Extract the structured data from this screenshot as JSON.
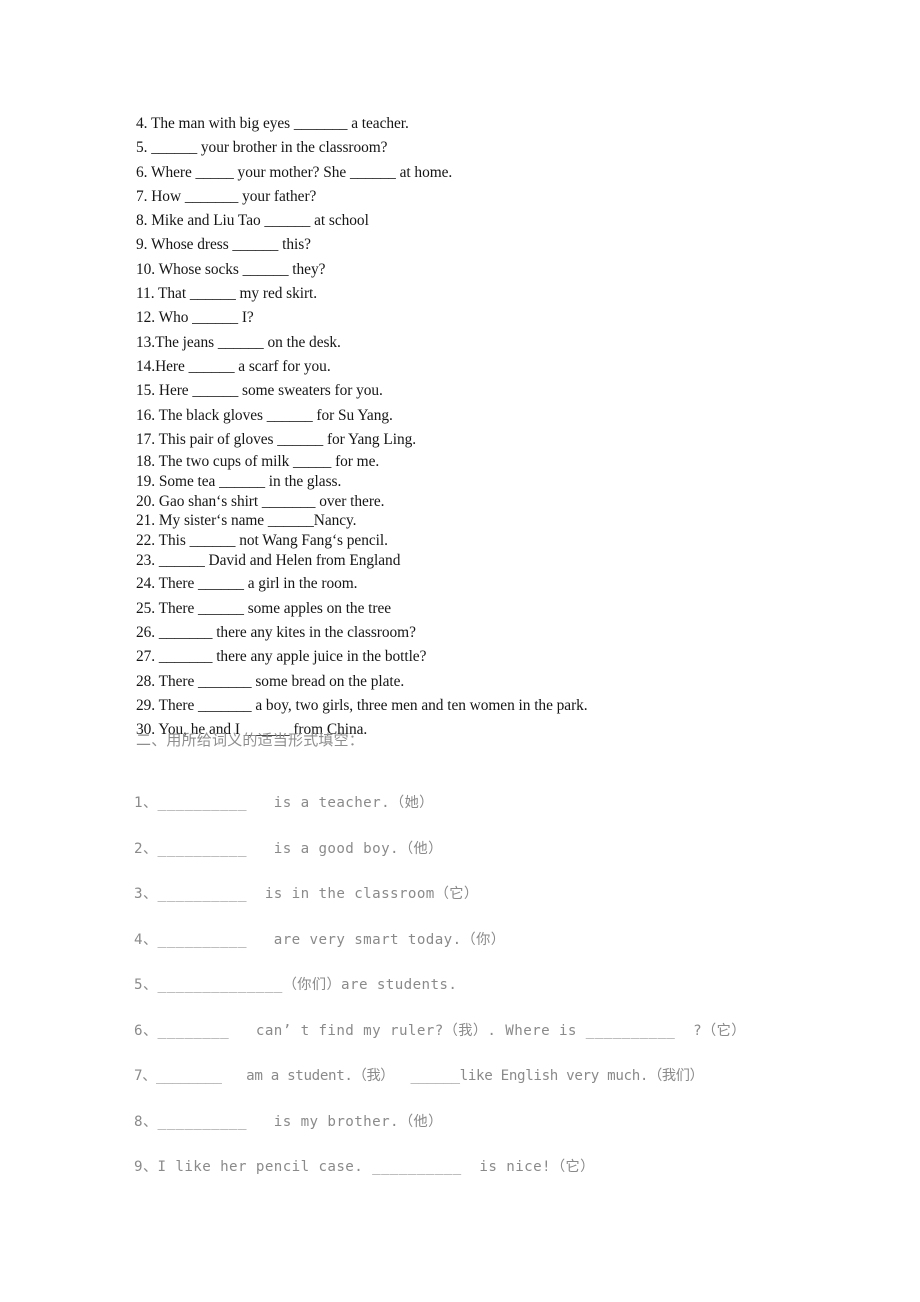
{
  "document": {
    "section1": {
      "items": [
        {
          "id": "q4",
          "text": "4. The man with big eyes _______ a teacher."
        },
        {
          "id": "q5",
          "text": "5. ______ your brother in the classroom?"
        },
        {
          "id": "q6",
          "text": "6. Where _____ your mother? She ______ at home."
        },
        {
          "id": "q7",
          "text": "7. How _______ your father?"
        },
        {
          "id": "q8",
          "text": "8. Mike and Liu Tao ______ at school"
        },
        {
          "id": "q9",
          "text": "9. Whose dress ______ this?"
        },
        {
          "id": "q10",
          "text": "10. Whose socks ______ they?"
        },
        {
          "id": "q11",
          "text": "11. That ______ my red skirt."
        },
        {
          "id": "q12",
          "text": "12. Who ______ I?"
        },
        {
          "id": "q13",
          "text": "13.The jeans ______ on the desk."
        },
        {
          "id": "q14",
          "text": "14.Here ______ a scarf for you."
        },
        {
          "id": "q15",
          "text": "15. Here ______ some sweaters for you."
        },
        {
          "id": "q16",
          "text": "16. The black gloves ______ for Su Yang."
        },
        {
          "id": "q17",
          "text": "17. This pair of gloves ______ for Yang Ling."
        },
        {
          "id": "q18",
          "text": "18. The two cups of milk _____ for me."
        },
        {
          "id": "q19",
          "text": "19. Some tea ______ in the glass."
        },
        {
          "id": "q20",
          "text": "20. Gao shan‘s shirt _______ over there."
        },
        {
          "id": "q21",
          "text": "21. My sister‘s name ______Nancy."
        },
        {
          "id": "q22",
          "text": "22. This ______ not Wang Fang‘s pencil."
        },
        {
          "id": "q23",
          "text": "23. ______ David and Helen from England"
        },
        {
          "id": "q24",
          "text": "24. There ______ a girl in the room."
        },
        {
          "id": "q25",
          "text": "25. There ______ some apples on the tree"
        },
        {
          "id": "q26",
          "text": "26. _______ there any kites in the classroom?"
        },
        {
          "id": "q27",
          "text": "27. _______ there any apple juice in the bottle?"
        },
        {
          "id": "q28",
          "text": "28. There _______ some bread on the plate."
        },
        {
          "id": "q29",
          "text": "29. There _______ a boy, two girls, three men and ten women in the park."
        },
        {
          "id": "q30",
          "text": "30. You, he and I ______ from China."
        }
      ]
    },
    "section2_heading": "二、用所给词义的适当形式填空：",
    "section2": {
      "items": [
        {
          "id": "b1",
          "text": "1、__________   is a teacher.（她）"
        },
        {
          "id": "b2",
          "text": "2、__________   is a good boy.（他）"
        },
        {
          "id": "b3",
          "text": "3、__________  is in the classroom（它）"
        },
        {
          "id": "b4",
          "text": "4、__________   are very smart today.（你）"
        },
        {
          "id": "b5",
          "text": "5、______________（你们）are students."
        },
        {
          "id": "b6",
          "text": "6、________   can’ t find my ruler?（我）. Where is __________  ?（它）"
        },
        {
          "id": "b7",
          "text": "7、________   am a student.（我）  ______like English very much.（我们）"
        },
        {
          "id": "b8",
          "text": "8、__________   is my brother.（他）"
        },
        {
          "id": "b9",
          "text": "9、I like her pencil case. __________  is nice!（它）"
        }
      ]
    }
  },
  "colors": {
    "section1_text": "#161616",
    "section2_text": "#8a8a8a",
    "heading_text": "#8e8e8e",
    "page_background": "#ffffff"
  }
}
